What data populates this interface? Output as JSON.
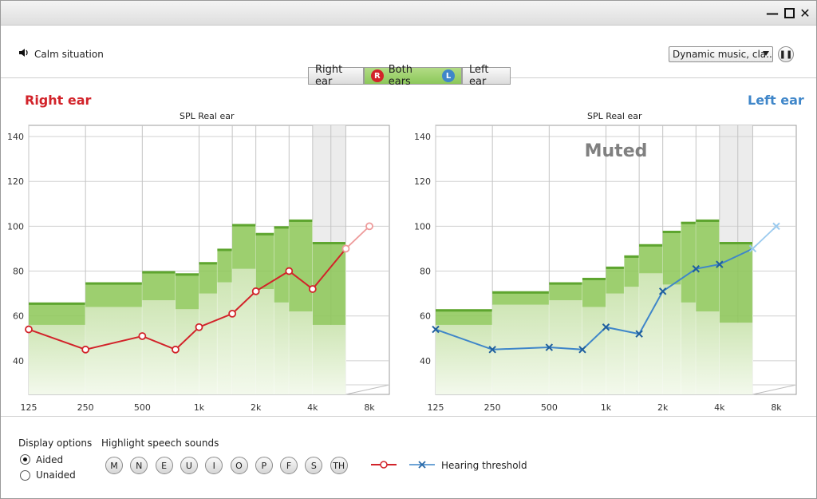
{
  "window": {
    "controls": [
      "minimize-icon",
      "maximize-icon",
      "close-icon"
    ]
  },
  "situation": {
    "icon": "speaker-icon",
    "label": "Calm situation"
  },
  "music": {
    "selected": "Dynamic music, cla...",
    "pause_icon": "pause-icon"
  },
  "ear_selector": {
    "right": "Right ear",
    "both": "Both ears",
    "left": "Left ear",
    "badge_r": "R",
    "badge_l": "L",
    "active": "both"
  },
  "colors": {
    "right": "#d2232a",
    "left": "#3f86c9",
    "aided_dark": "#7cbf42",
    "aided_light": "#d8edc4"
  },
  "right_panel": {
    "ear_title": "Right ear",
    "chart_title": "SPL Real ear"
  },
  "left_panel": {
    "ear_title": "Left ear",
    "chart_title": "SPL Real ear",
    "muted": "Muted"
  },
  "display_options": {
    "title": "Display options",
    "aided": "Aided",
    "unaided": "Unaided",
    "selected": "Aided"
  },
  "speech": {
    "title": "Highlight speech sounds",
    "sounds": [
      "M",
      "N",
      "E",
      "U",
      "I",
      "O",
      "P",
      "F",
      "S",
      "TH"
    ]
  },
  "legend": {
    "threshold": "Hearing threshold"
  },
  "chart_data": [
    {
      "type": "line",
      "title": "SPL Real ear",
      "x_ticks": [
        "125",
        "250",
        "500",
        "1k",
        "2k",
        "4k",
        "8k"
      ],
      "y_ticks": [
        40,
        60,
        80,
        100,
        120,
        140
      ],
      "ylim": [
        25,
        145
      ],
      "series": [
        {
          "x": [
            "125",
            "250",
            "500",
            "750",
            "1k",
            "1.5k",
            "2k",
            "3k",
            "4k",
            "6k",
            "8k"
          ],
          "values": [
            54,
            45,
            51,
            45,
            55,
            61,
            71,
            80,
            72,
            90,
            100
          ]
        }
      ],
      "bands": [
        {
          "x": [
            "125",
            "250"
          ],
          "top": 66,
          "mid": 56
        },
        {
          "x": [
            "250",
            "500"
          ],
          "top": 75,
          "mid": 64
        },
        {
          "x": [
            "500",
            "750"
          ],
          "top": 80,
          "mid": 67
        },
        {
          "x": [
            "750",
            "1k"
          ],
          "top": 79,
          "mid": 63
        },
        {
          "x": [
            "1k",
            "1.25k"
          ],
          "top": 84,
          "mid": 70
        },
        {
          "x": [
            "1.25k",
            "1.5k"
          ],
          "top": 90,
          "mid": 75
        },
        {
          "x": [
            "1.5k",
            "2k"
          ],
          "top": 101,
          "mid": 81
        },
        {
          "x": [
            "2k",
            "2.5k"
          ],
          "top": 97,
          "mid": 72
        },
        {
          "x": [
            "2.5k",
            "3k"
          ],
          "top": 100,
          "mid": 66
        },
        {
          "x": [
            "3k",
            "4k"
          ],
          "top": 103,
          "mid": 62
        },
        {
          "x": [
            "4k",
            "6k"
          ],
          "top": 93,
          "mid": 56
        }
      ]
    },
    {
      "type": "line",
      "title": "SPL Real ear",
      "x_ticks": [
        "125",
        "250",
        "500",
        "1k",
        "2k",
        "4k",
        "8k"
      ],
      "y_ticks": [
        40,
        60,
        80,
        100,
        120,
        140
      ],
      "ylim": [
        25,
        145
      ],
      "series": [
        {
          "name": "Hearing threshold",
          "x": [
            "125",
            "250",
            "500",
            "750",
            "1k",
            "1.5k",
            "2k",
            "3k",
            "4k",
            "6k",
            "8k"
          ],
          "values": [
            54,
            45,
            46,
            45,
            55,
            52,
            71,
            81,
            83,
            90,
            100
          ]
        }
      ],
      "bands": [
        {
          "x": [
            "125",
            "250"
          ],
          "top": 63,
          "mid": 56
        },
        {
          "x": [
            "250",
            "500"
          ],
          "top": 71,
          "mid": 65
        },
        {
          "x": [
            "500",
            "750"
          ],
          "top": 75,
          "mid": 67
        },
        {
          "x": [
            "750",
            "1k"
          ],
          "top": 77,
          "mid": 64
        },
        {
          "x": [
            "1k",
            "1.25k"
          ],
          "top": 82,
          "mid": 70
        },
        {
          "x": [
            "1.25k",
            "1.5k"
          ],
          "top": 87,
          "mid": 73
        },
        {
          "x": [
            "1.5k",
            "2k"
          ],
          "top": 92,
          "mid": 79
        },
        {
          "x": [
            "2k",
            "2.5k"
          ],
          "top": 98,
          "mid": 74
        },
        {
          "x": [
            "2.5k",
            "3k"
          ],
          "top": 102,
          "mid": 66
        },
        {
          "x": [
            "3k",
            "4k"
          ],
          "top": 103,
          "mid": 62
        },
        {
          "x": [
            "4k",
            "6k"
          ],
          "top": 93,
          "mid": 57
        }
      ]
    }
  ]
}
